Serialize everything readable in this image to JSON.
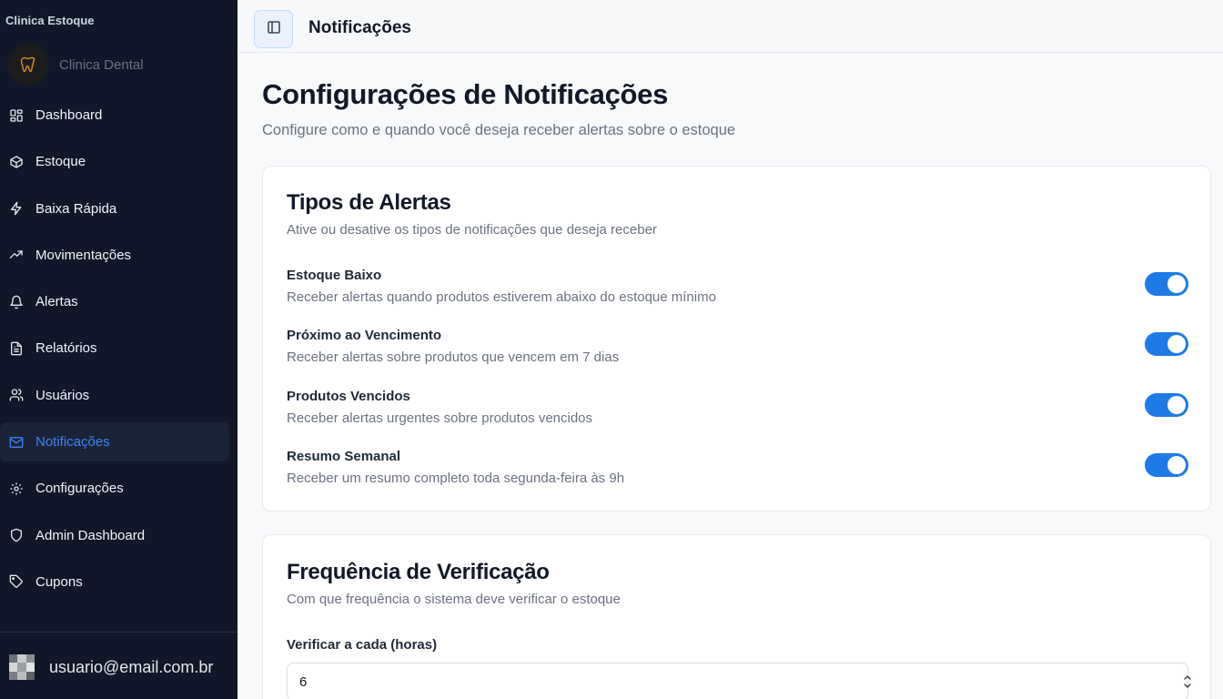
{
  "app": {
    "name": "Clinica Estoque",
    "clinic_name": "Clinica Dental"
  },
  "sidebar": {
    "items": [
      {
        "label": "Dashboard",
        "icon": "dashboard-icon"
      },
      {
        "label": "Estoque",
        "icon": "box-icon"
      },
      {
        "label": "Baixa Rápida",
        "icon": "lightning-icon"
      },
      {
        "label": "Movimentações",
        "icon": "trending-up-icon"
      },
      {
        "label": "Alertas",
        "icon": "bell-icon"
      },
      {
        "label": "Relatórios",
        "icon": "file-text-icon"
      },
      {
        "label": "Usuários",
        "icon": "users-icon"
      },
      {
        "label": "Notificações",
        "icon": "mail-icon",
        "active": true
      },
      {
        "label": "Configurações",
        "icon": "gear-icon"
      },
      {
        "label": "Admin Dashboard",
        "icon": "shield-icon"
      },
      {
        "label": "Cupons",
        "icon": "tag-icon"
      }
    ],
    "user_email": "usuario@email.com.br"
  },
  "topbar": {
    "title": "Notificações"
  },
  "page": {
    "title": "Configurações de Notificações",
    "subtitle": "Configure como e quando você deseja receber alertas sobre o estoque"
  },
  "alert_types": {
    "title": "Tipos de Alertas",
    "description": "Ative ou desative os tipos de notificações que deseja receber",
    "settings": [
      {
        "label": "Estoque Baixo",
        "description": "Receber alertas quando produtos estiverem abaixo do estoque mínimo",
        "enabled": true
      },
      {
        "label": "Próximo ao Vencimento",
        "description": "Receber alertas sobre produtos que vencem em 7 dias",
        "enabled": true
      },
      {
        "label": "Produtos Vencidos",
        "description": "Receber alertas urgentes sobre produtos vencidos",
        "enabled": true
      },
      {
        "label": "Resumo Semanal",
        "description": "Receber um resumo completo toda segunda-feira às 9h",
        "enabled": true
      }
    ]
  },
  "frequency": {
    "title": "Frequência de Verificação",
    "description": "Com que frequência o sistema deve verificar o estoque",
    "field_label": "Verificar a cada (horas)",
    "value": "6"
  },
  "colors": {
    "sidebar_bg": "#0f1729",
    "accent": "#1d7be6",
    "active_text": "#3b82f6"
  }
}
